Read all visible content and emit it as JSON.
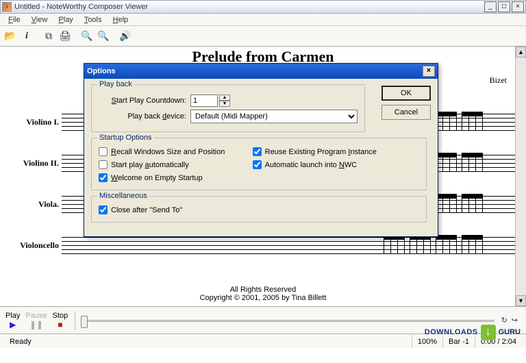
{
  "window": {
    "title": "Untitled - NoteWorthy Composer Viewer",
    "min": "_",
    "max": "□",
    "close": "×"
  },
  "menu": {
    "file": "File",
    "view": "View",
    "play": "Play",
    "tools": "Tools",
    "help": "Help"
  },
  "score": {
    "title": "Prelude from Carmen",
    "composer": "Bizet",
    "instruments": [
      "Violino I.",
      "Violino II.",
      "Viola.",
      "Violoncello"
    ],
    "rights_line1": "All Rights Reserved",
    "rights_line2": "Copyright © 2001, 2005 by Tina Billett"
  },
  "transport": {
    "play": "Play",
    "pause": "Pause",
    "stop": "Stop"
  },
  "status": {
    "ready": "Ready",
    "zoom": "100%",
    "bar": "Bar -1",
    "time": "0:00 / 2:04"
  },
  "dialog": {
    "title": "Options",
    "ok": "OK",
    "cancel": "Cancel",
    "playback": {
      "legend": "Play back",
      "countdown_label": "Start Play Countdown:",
      "countdown_value": "1",
      "device_label": "Play back device:",
      "device_value": "Default (Midi Mapper)"
    },
    "startup": {
      "legend": "Startup Options",
      "recall": "Recall Windows Size and Position",
      "recall_checked": false,
      "autoplay": "Start play automatically",
      "autoplay_checked": false,
      "welcome": "Welcome on Empty Startup",
      "welcome_checked": true,
      "reuse": "Reuse Existing Program Instance",
      "reuse_checked": true,
      "autolaunch": "Automatic launch into NWC",
      "autolaunch_checked": true
    },
    "misc": {
      "legend": "Miscellaneous",
      "close_after": "Close after \"Send To\"",
      "close_after_checked": true
    }
  },
  "watermark": {
    "left": "DOWNLOADS",
    "right": "GURU"
  }
}
